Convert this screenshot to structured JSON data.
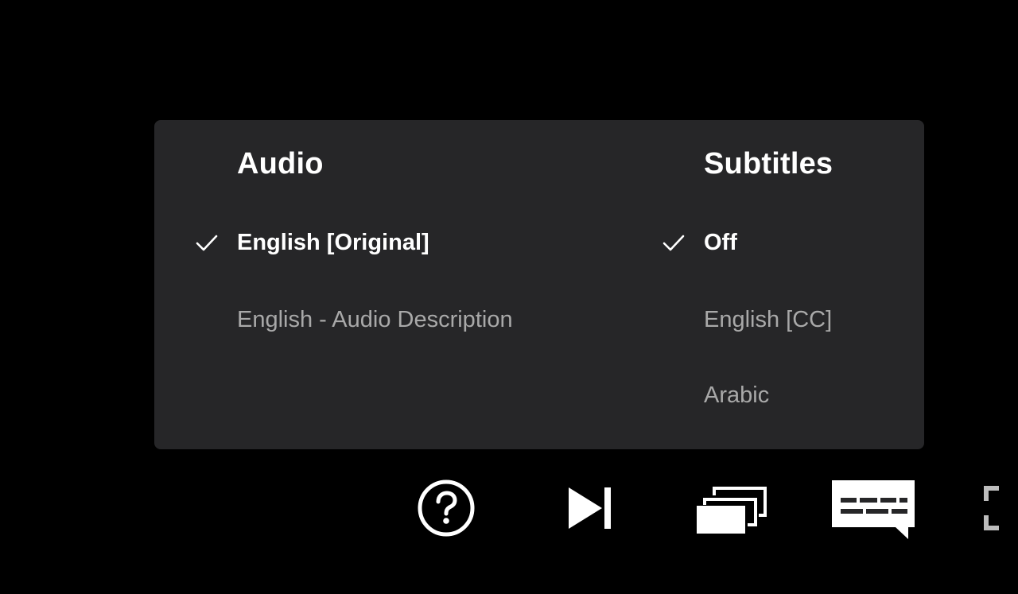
{
  "audio": {
    "title": "Audio",
    "options": [
      {
        "label": "English [Original]",
        "selected": true
      },
      {
        "label": "English - Audio Description",
        "selected": false
      }
    ]
  },
  "subtitles": {
    "title": "Subtitles",
    "options": [
      {
        "label": "Off",
        "selected": true
      },
      {
        "label": "English [CC]",
        "selected": false
      },
      {
        "label": "Arabic",
        "selected": false
      }
    ]
  },
  "controls": [
    {
      "icon": "help-icon"
    },
    {
      "icon": "next-episode-icon"
    },
    {
      "icon": "episodes-icon"
    },
    {
      "icon": "subtitles-audio-icon"
    },
    {
      "icon": "fullscreen-icon"
    }
  ],
  "colors": {
    "panel_bg": "#262628",
    "selected_text": "#ffffff",
    "unselected_text": "#a9a9a9",
    "page_bg": "#000000"
  }
}
